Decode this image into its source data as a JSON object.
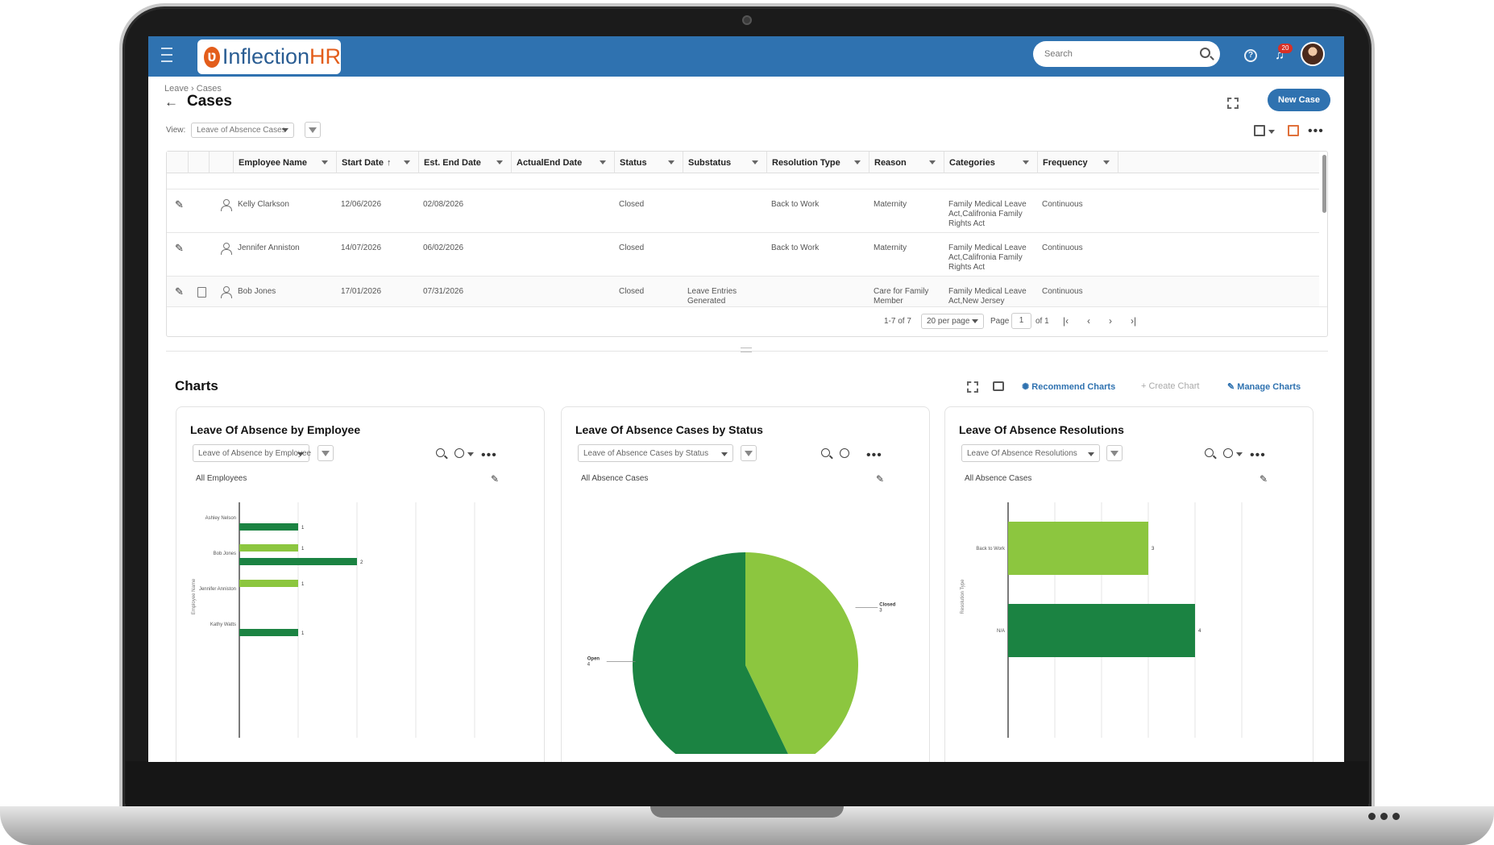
{
  "header": {
    "app_name_prefix": "Inflection",
    "app_name_suffix": "HR",
    "search_placeholder": "Search",
    "notification_count": "20"
  },
  "breadcrumb": "Leave › Cases",
  "page_title": "Cases",
  "new_case_label": "New Case",
  "view": {
    "label": "View:",
    "selected": "Leave of Absence Cases"
  },
  "table": {
    "columns": [
      "Employee Name",
      "Start Date",
      "Est. End Date",
      "ActualEnd Date",
      "Status",
      "Substatus",
      "Resolution Type",
      "Reason",
      "Categories",
      "Frequency"
    ],
    "rows": [
      {
        "employee": "Kelly Clarkson",
        "start": "12/06/2026",
        "est_end": "02/08/2026",
        "actual_end": "",
        "status": "Closed",
        "substatus": "",
        "resolution": "Back to Work",
        "reason": "Maternity",
        "categories": "Family Medical Leave Act,Califronia Family Rights Act",
        "frequency": "Continuous"
      },
      {
        "employee": "Jennifer Anniston",
        "start": "14/07/2026",
        "est_end": "06/02/2026",
        "actual_end": "",
        "status": "Closed",
        "substatus": "",
        "resolution": "Back to Work",
        "reason": "Maternity",
        "categories": "Family Medical Leave Act,Califronia Family Rights Act",
        "frequency": "Continuous"
      },
      {
        "employee": "Bob Jones",
        "start": "17/01/2026",
        "est_end": "07/31/2026",
        "actual_end": "",
        "status": "Closed",
        "substatus": "Leave Entries Generated",
        "resolution": "",
        "reason": "Care for Family Member",
        "categories": "Family Medical Leave Act,New Jersey",
        "frequency": "Continuous"
      }
    ],
    "pager": {
      "range": "1-7 of 7",
      "per_page": "20 per page",
      "page_label": "Page",
      "page": "1",
      "of": "of 1"
    }
  },
  "charts_section": {
    "title": "Charts",
    "recommend": "Recommend Charts",
    "create": "Create Chart",
    "manage": "Manage Charts"
  },
  "cards": [
    {
      "title": "Leave Of Absence by Employee",
      "select": "Leave of Absence by Employee",
      "subtitle": "All Employees"
    },
    {
      "title": "Leave Of Absence Cases by Status",
      "select": "Leave of Absence Cases by Status",
      "subtitle": "All Absence Cases"
    },
    {
      "title": "Leave Of Absence Resolutions",
      "select": "Leave Of Absence Resolutions",
      "subtitle": "All Absence Cases"
    }
  ],
  "colors": {
    "header_blue": "#2f72b0",
    "dark_green": "#1b8342",
    "light_green": "#8cc63f"
  },
  "chart_data": [
    {
      "type": "bar",
      "orientation": "horizontal",
      "ylabel": "Employee Name",
      "categories": [
        "Ashley Nelson",
        "Bob Jones",
        "Jennifer Anniston",
        "Kathy Watts"
      ],
      "series": [
        {
          "values": [
            1,
            1,
            1,
            1
          ]
        },
        {
          "values": [
            0,
            2,
            0,
            0
          ]
        }
      ],
      "bars": [
        {
          "category": "Ashley Nelson",
          "value": 1,
          "color": "#1b8342"
        },
        {
          "category": "Bob Jones",
          "value": 1,
          "color": "#8cc63f"
        },
        {
          "category": "Bob Jones",
          "value": 2,
          "color": "#1b8342"
        },
        {
          "category": "Jennifer Anniston",
          "value": 1,
          "color": "#8cc63f"
        },
        {
          "category": "Kathy Watts",
          "value": 1,
          "color": "#1b8342"
        }
      ]
    },
    {
      "type": "pie",
      "slices": [
        {
          "label": "Closed",
          "value": 3,
          "color": "#8cc63f"
        },
        {
          "label": "Open",
          "value": 4,
          "color": "#1b8342"
        }
      ]
    },
    {
      "type": "bar",
      "orientation": "horizontal",
      "ylabel": "Resolution Type",
      "categories": [
        "Back to Work",
        "N/A"
      ],
      "values": [
        3,
        4
      ],
      "colors": [
        "#8cc63f",
        "#1b8342"
      ]
    }
  ]
}
